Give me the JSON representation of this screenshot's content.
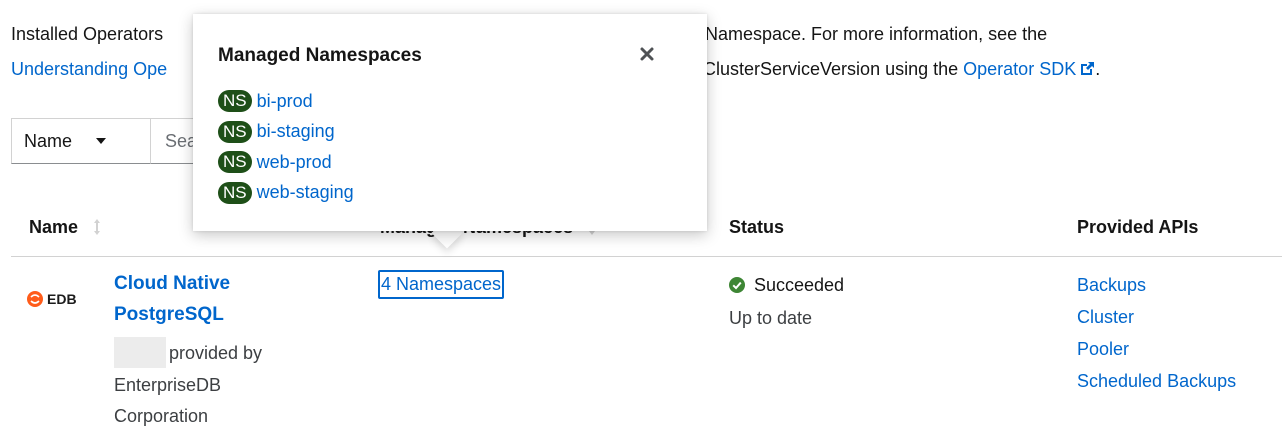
{
  "description": {
    "line1_left": "Installed Operators",
    "line1_right": "s Namespace. For more information, see the",
    "line2_left_link": "Understanding Ope",
    "line2_right": "ClusterServiceVersion using the",
    "line2_right_link": "Operator SDK",
    "line2_end": "."
  },
  "toolbar": {
    "filter_select_value": "Name",
    "search_placeholder": "Sea"
  },
  "table": {
    "columns": {
      "name": "Name",
      "managed_namespaces": "Managed Namespaces",
      "status": "Status",
      "provided_apis": "Provided APIs"
    },
    "rows": [
      {
        "logo_text": "EDB",
        "name": "Cloud Native PostgreSQL",
        "provider_prefix": "provided by",
        "provider_name": "EnterpriseDB Corporation",
        "namespaces_link": "4 Namespaces",
        "status": "Succeeded",
        "status_detail": "Up to date",
        "apis": [
          "Backups",
          "Cluster",
          "Pooler",
          "Scheduled Backups"
        ]
      }
    ]
  },
  "popover": {
    "title": "Managed Namespaces",
    "badge": "NS",
    "namespaces": [
      "bi-prod",
      "bi-staging",
      "web-prod",
      "web-staging"
    ]
  },
  "colors": {
    "link": "#0066cc",
    "ns_badge_bg": "#1e4f18",
    "success": "#3e8635",
    "edb_orange": "#ff5c1a"
  },
  "icons": {
    "external_link": "external-link-icon",
    "close": "close-icon",
    "sort": "sort-icon",
    "success": "check-circle-icon",
    "caret": "caret-down-icon"
  }
}
